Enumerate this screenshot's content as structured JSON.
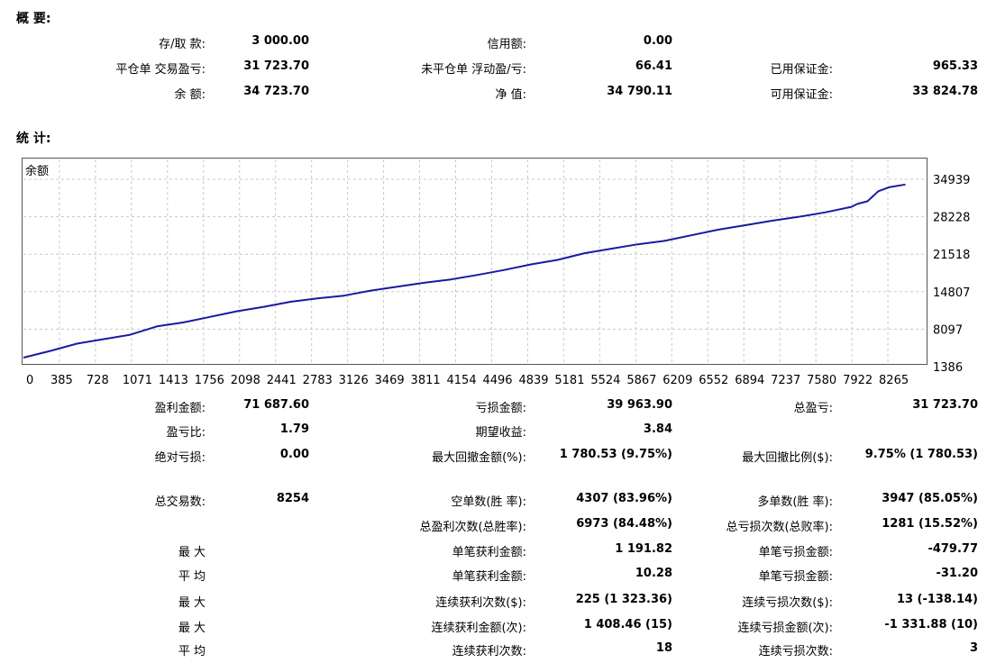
{
  "summary": {
    "title": "概 要:",
    "rows": [
      [
        {
          "label": "存/取 款:",
          "value": "3 000.00"
        },
        {
          "label": "信用额:",
          "value": "0.00"
        },
        {
          "label": "",
          "value": ""
        }
      ],
      [
        {
          "label": "平仓单 交易盈亏:",
          "value": "31 723.70"
        },
        {
          "label": "未平仓单 浮动盈/亏:",
          "value": "66.41"
        },
        {
          "label": "已用保证金:",
          "value": "965.33"
        }
      ],
      [
        {
          "label": "余 额:",
          "value": "34 723.70"
        },
        {
          "label": "净 值:",
          "value": "34 790.11"
        },
        {
          "label": "可用保证金:",
          "value": "33 824.78"
        }
      ]
    ]
  },
  "stats": {
    "title": "统 计:",
    "rows": [
      [
        {
          "label": "盈利金额:",
          "value": "71 687.60"
        },
        {
          "label": "亏损金额:",
          "value": "39 963.90"
        },
        {
          "label": "总盈亏:",
          "value": "31 723.70"
        }
      ],
      [
        {
          "label": "盈亏比:",
          "value": "1.79"
        },
        {
          "label": "期望收益:",
          "value": "3.84"
        },
        {
          "label": "",
          "value": ""
        }
      ],
      [
        {
          "label": "绝对亏损:",
          "value": "0.00"
        },
        {
          "label": "最大回撤金额(%):",
          "value": "1 780.53 (9.75%)"
        },
        {
          "label": "最大回撤比例($):",
          "value": "9.75% (1 780.53)"
        }
      ],
      [
        {
          "label": "总交易数:",
          "value": "8254"
        },
        {
          "label": "空单数(胜 率):",
          "value": "4307 (83.96%)"
        },
        {
          "label": "多单数(胜 率):",
          "value": "3947 (85.05%)"
        }
      ],
      [
        {
          "label": "",
          "value": ""
        },
        {
          "label": "总盈利次数(总胜率):",
          "value": "6973 (84.48%)"
        },
        {
          "label": "总亏损次数(总败率):",
          "value": "1281 (15.52%)"
        }
      ],
      [
        {
          "label": "最 大",
          "value": ""
        },
        {
          "label": "单笔获利金额:",
          "value": "1 191.82"
        },
        {
          "label": "单笔亏损金额:",
          "value": "-479.77"
        }
      ],
      [
        {
          "label": "平 均",
          "value": ""
        },
        {
          "label": "单笔获利金额:",
          "value": "10.28"
        },
        {
          "label": "单笔亏损金额:",
          "value": "-31.20"
        }
      ],
      [
        {
          "label": "最 大",
          "value": ""
        },
        {
          "label": "连续获利次数($):",
          "value": "225 (1 323.36)"
        },
        {
          "label": "连续亏损次数($):",
          "value": "13 (-138.14)"
        }
      ],
      [
        {
          "label": "最 大",
          "value": ""
        },
        {
          "label": "连续获利金额(次):",
          "value": "1 408.46 (15)"
        },
        {
          "label": "连续亏损金额(次):",
          "value": "-1 331.88 (10)"
        }
      ],
      [
        {
          "label": "平 均",
          "value": ""
        },
        {
          "label": "连续获利次数:",
          "value": "18"
        },
        {
          "label": "连续亏损次数:",
          "value": "3"
        }
      ]
    ]
  },
  "colors": {
    "line": "#1a1aa0",
    "grid": "#c8c8c8",
    "border": "#555555"
  },
  "chart_data": {
    "type": "line",
    "title": "余额",
    "xlabel": "",
    "ylabel": "",
    "x_ticks": [
      "0",
      "385",
      "728",
      "1071",
      "1413",
      "1756",
      "2098",
      "2441",
      "2783",
      "3126",
      "3469",
      "3811",
      "4154",
      "4496",
      "4839",
      "5181",
      "5524",
      "5867",
      "6209",
      "6552",
      "6894",
      "7237",
      "7580",
      "7922",
      "8265"
    ],
    "y_ticks": [
      "34939",
      "28228",
      "21518",
      "14807",
      "8097",
      "1386"
    ],
    "xlim": [
      0,
      8427
    ],
    "ylim": [
      1386,
      34939
    ],
    "grid": true,
    "series": [
      {
        "x": [
          0,
          250,
          500,
          750,
          1000,
          1250,
          1500,
          1750,
          2000,
          2250,
          2500,
          2750,
          3000,
          3250,
          3500,
          3750,
          4000,
          4250,
          4500,
          4750,
          5000,
          5250,
          5500,
          5750,
          6000,
          6250,
          6500,
          6750,
          7000,
          7250,
          7500,
          7750,
          7800,
          7900,
          8000,
          8100,
          8254
        ],
        "y": [
          3000,
          4200,
          5500,
          6300,
          7100,
          8600,
          9300,
          10300,
          11300,
          12100,
          13000,
          13600,
          14100,
          15000,
          15700,
          16400,
          17000,
          17800,
          18700,
          19700,
          20500,
          21700,
          22500,
          23300,
          23900,
          24900,
          25900,
          26700,
          27500,
          28200,
          29000,
          30000,
          30500,
          31000,
          32800,
          33500,
          34000
        ]
      }
    ]
  }
}
